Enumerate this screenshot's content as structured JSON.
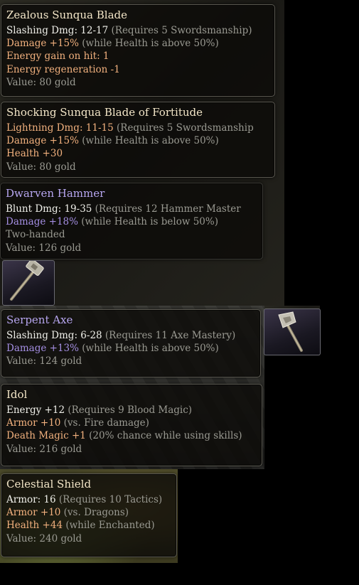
{
  "colors": {
    "standard_name": "#f3e6c8",
    "enhanced_name": "#b7a6f0",
    "base_stat": "#f0f0ea",
    "modifier_orange": "#f2b17e",
    "modifier_purple": "#a48ee2",
    "requirement_gray": "#9a9a92"
  },
  "icons": {
    "hammer": "war-hammer-icon",
    "axe": "battle-axe-icon"
  },
  "tooltips": [
    {
      "name": "Zealous Sunqua Blade",
      "lines": [
        {
          "main": "Slashing Dmg: 12-17",
          "note": " (Requires 5 Swordsmanship)"
        },
        {
          "main": "Damage +15%",
          "note": " (while Health is above 50%)"
        },
        {
          "main": "Energy gain on hit: 1",
          "note": ""
        },
        {
          "main": "Energy regeneration -1",
          "note": ""
        },
        {
          "main": "Value: 80 gold",
          "note": ""
        }
      ]
    },
    {
      "name": "Shocking Sunqua Blade of Fortitude",
      "lines": [
        {
          "main": "Lightning Dmg: 11-15",
          "note": " (Requires 5 Swordsmanship"
        },
        {
          "main": "Damage +15%",
          "note": " (while Health is above 50%)"
        },
        {
          "main": "Health +30",
          "note": ""
        },
        {
          "main": "Value: 80 gold",
          "note": ""
        }
      ]
    },
    {
      "name": "Dwarven Hammer",
      "lines": [
        {
          "main": "Blunt Dmg: 19-35",
          "note": " (Requires 12 Hammer Master"
        },
        {
          "main": "Damage +18%",
          "note": " (while Health is below 50%)"
        },
        {
          "main": "Two-handed",
          "note": ""
        },
        {
          "main": "Value: 126 gold",
          "note": ""
        }
      ]
    },
    {
      "name": "Serpent Axe",
      "lines": [
        {
          "main": "Slashing Dmg: 6-28",
          "note": " (Requires 11 Axe Mastery)"
        },
        {
          "main": "Damage +13%",
          "note": " (while Health is above 50%)"
        },
        {
          "main": "Value: 124 gold",
          "note": ""
        }
      ]
    },
    {
      "name": "Idol",
      "lines": [
        {
          "main": "Energy +12",
          "note": " (Requires 9 Blood Magic)"
        },
        {
          "main": "Armor +10",
          "note": " (vs. Fire damage)"
        },
        {
          "main": "Death Magic +1",
          "note": " (20% chance while using skills)"
        },
        {
          "main": "Value: 216 gold",
          "note": ""
        }
      ]
    },
    {
      "name": "Celestial Shield",
      "lines": [
        {
          "main": "Armor: 16",
          "note": " (Requires 10 Tactics)"
        },
        {
          "main": "Armor +10",
          "note": " (vs. Dragons)"
        },
        {
          "main": "Health +44",
          "note": " (while Enchanted)"
        },
        {
          "main": "Value: 240 gold",
          "note": ""
        }
      ]
    }
  ]
}
